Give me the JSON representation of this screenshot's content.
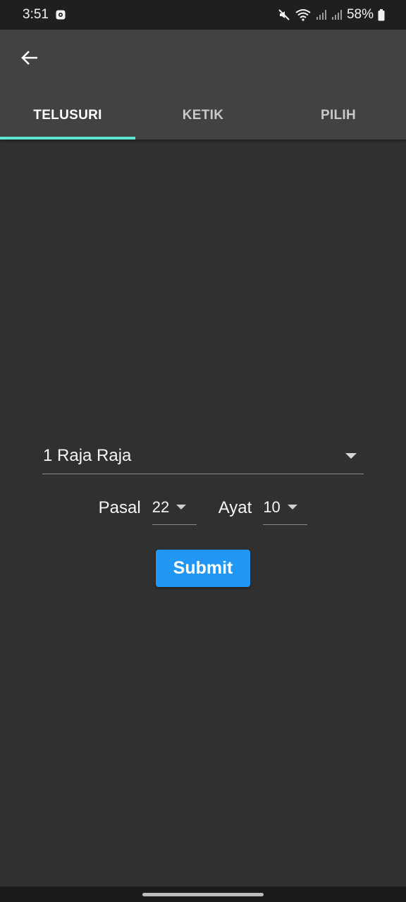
{
  "status_bar": {
    "time": "3:51",
    "battery": "58%",
    "icons": [
      "notification-icon",
      "mute-icon",
      "wifi-icon",
      "signal-icon",
      "signal-icon",
      "battery-icon"
    ]
  },
  "app_bar": {
    "back_icon": "arrow-left-icon",
    "tabs": [
      {
        "label": "TELUSURI",
        "active": true
      },
      {
        "label": "KETIK",
        "active": false
      },
      {
        "label": "PILIH",
        "active": false
      }
    ],
    "indicator_color": "#5ee7cf"
  },
  "form": {
    "book": "1 Raja Raja",
    "pasal_label": "Pasal",
    "pasal_value": "22",
    "ayat_label": "Ayat",
    "ayat_value": "10",
    "submit_label": "Submit",
    "submit_color": "#2196f3"
  }
}
